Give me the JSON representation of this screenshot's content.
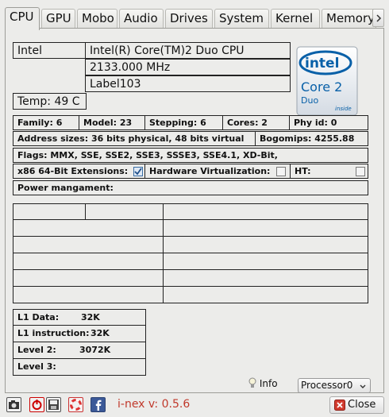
{
  "tabs": [
    "CPU",
    "GPU",
    "Mobo",
    "Audio",
    "Drives",
    "System",
    "Kernel",
    "Memory"
  ],
  "cpu": {
    "vendor": "Intel",
    "model": "Intel(R) Core(TM)2 Duo CPU",
    "clock": "2133.000 MHz",
    "label": "Label103",
    "temp": "Temp: 49 C",
    "family": "Family:  6",
    "model_num": "Model:  23",
    "stepping": "Stepping:  6",
    "cores": "Cores:  2",
    "phy_id": "Phy id:  0",
    "address_sizes": "Address sizes:  36 bits physical, 48 bits virtual",
    "bogomips": "Bogomips:  4255.88",
    "flags": "Flags: MMX, SSE, SSE2, SSE3, SSSE3, SSE4.1, XD-Bit,",
    "x86_64_label": "x86 64-Bit Extensions:",
    "x86_64_checked": true,
    "hw_virt_label": "Hardware Virtualization:",
    "hw_virt_checked": false,
    "ht_label": "HT:",
    "ht_checked": false,
    "power": "Power mangament:"
  },
  "logo": {
    "brand": "intel",
    "line": "Core 2",
    "sub": "Duo",
    "tag": "inside"
  },
  "cache": {
    "l1_data_label": "L1 Data:",
    "l1_data": "32K",
    "l1_inst_label": "L1 instruction:",
    "l1_inst": "32K",
    "l2_label": "Level 2:",
    "l2": "3072K",
    "l3_label": "Level 3:",
    "l3": ""
  },
  "footer": {
    "info": "Info",
    "selector": "Processor0",
    "version": "i-nex v: 0.5.6",
    "close": "Close"
  },
  "colors": {
    "version": "#c0392b",
    "intel_blue": "#0860a8"
  }
}
